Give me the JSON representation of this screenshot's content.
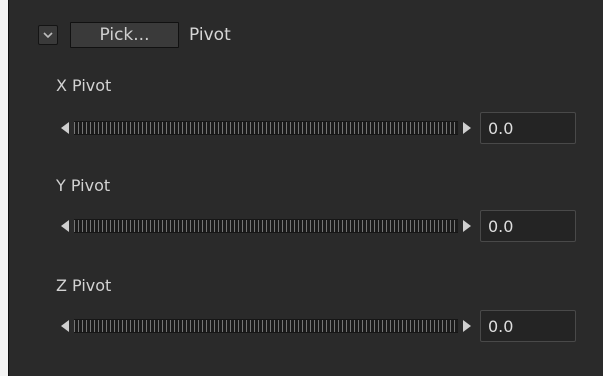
{
  "section": {
    "title": "Pivot",
    "pick_label": "Pick...",
    "toggle_icon": "chevron-down-icon"
  },
  "params": [
    {
      "label": "X Pivot",
      "value": "0.0"
    },
    {
      "label": "Y Pivot",
      "value": "0.0"
    },
    {
      "label": "Z Pivot",
      "value": "0.0"
    }
  ],
  "colors": {
    "panel_bg": "#2a2a2a",
    "text": "#d2d2d2",
    "tick": "#767676"
  }
}
